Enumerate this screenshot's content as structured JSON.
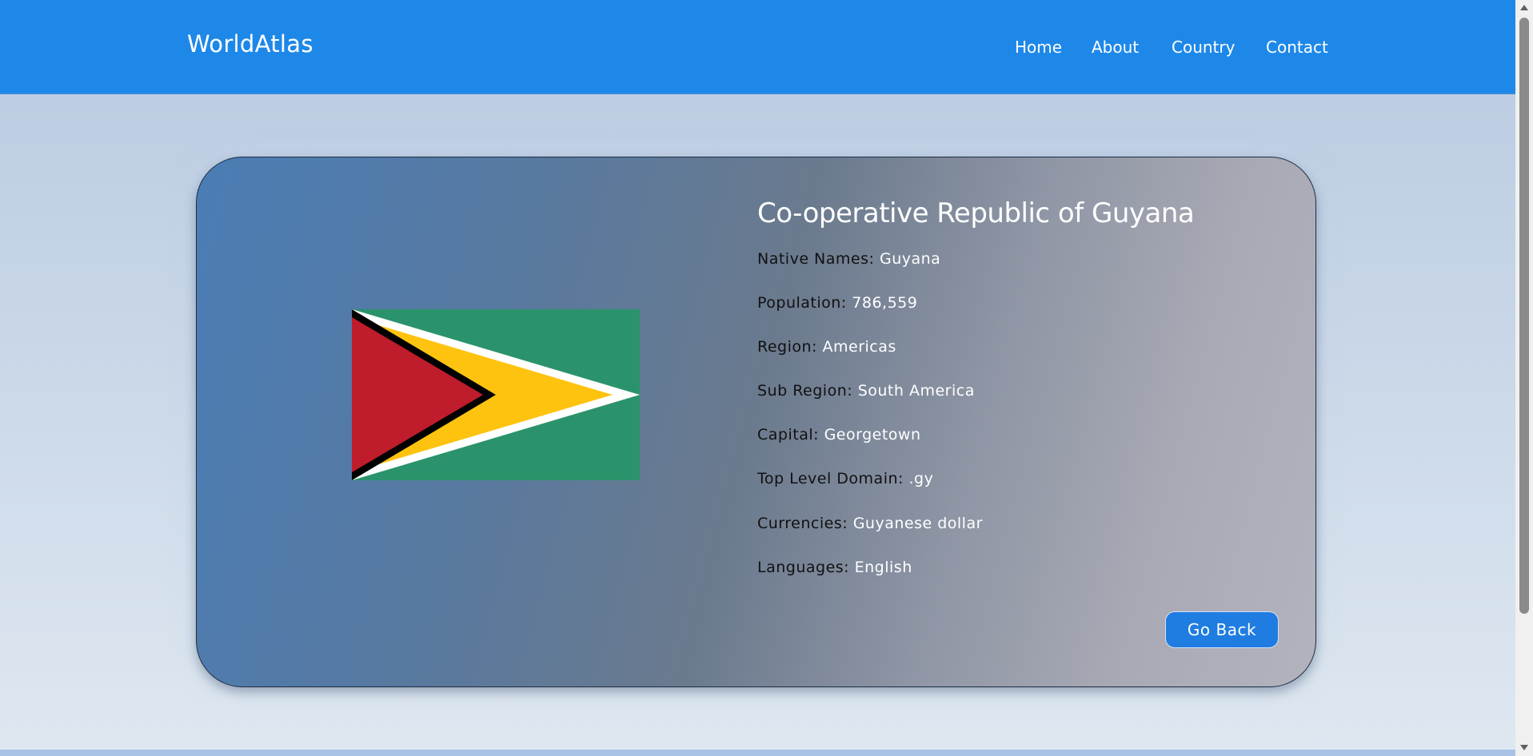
{
  "brand": "WorldAtlas",
  "nav": {
    "home": "Home",
    "about": "About",
    "country": "Country",
    "contact": "Contact"
  },
  "country": {
    "title": "Co-operative Republic of Guyana",
    "fields": [
      {
        "label": "Native Names:",
        "value": "Guyana"
      },
      {
        "label": "Population:",
        "value": "786,559"
      },
      {
        "label": "Region:",
        "value": "Americas"
      },
      {
        "label": "Sub Region:",
        "value": "South America"
      },
      {
        "label": "Capital:",
        "value": "Georgetown"
      },
      {
        "label": "Top Level Domain:",
        "value": ".gy"
      },
      {
        "label": "Currencies:",
        "value": "Guyanese dollar"
      },
      {
        "label": "Languages:",
        "value": "English"
      }
    ]
  },
  "buttons": {
    "go_back": "Go Back"
  },
  "colors": {
    "navbar": "#1e88e9",
    "flag_green": "#2b936b",
    "flag_yellow": "#fec30f",
    "flag_red": "#bf1c2c",
    "button": "#1f7ce0"
  },
  "icons": {
    "flag": "flag-of-guyana"
  }
}
